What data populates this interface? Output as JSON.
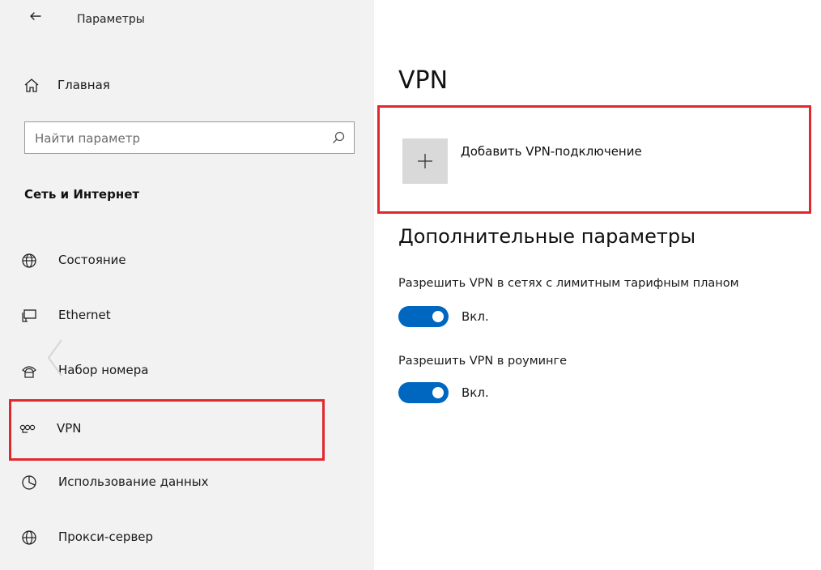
{
  "window": {
    "title": "Параметры"
  },
  "sidebar": {
    "home_label": "Главная",
    "search": {
      "placeholder": "Найти параметр"
    },
    "section_title": "Сеть и Интернет",
    "items": [
      {
        "label": "Состояние",
        "icon": "globe-status-icon"
      },
      {
        "label": "Ethernet",
        "icon": "ethernet-icon"
      },
      {
        "label": "Набор номера",
        "icon": "dialup-phone-icon"
      },
      {
        "label": "VPN",
        "icon": "vpn-icon",
        "selected": true
      },
      {
        "label": "Использование данных",
        "icon": "data-usage-icon"
      },
      {
        "label": "Прокси-сервер",
        "icon": "globe-icon"
      }
    ]
  },
  "main": {
    "title": "VPN",
    "add_vpn_label": "Добавить VPN-подключение",
    "advanced_heading": "Дополнительные параметры",
    "settings": [
      {
        "label": "Разрешить VPN в сетях с лимитным тарифным планом",
        "state": "Вкл.",
        "on": true
      },
      {
        "label": "Разрешить VPN в роуминге",
        "state": "Вкл.",
        "on": true
      }
    ]
  },
  "colors": {
    "accent": "#0067c0",
    "highlight_border": "#e0282e",
    "sidebar_bg": "#f2f2f2"
  }
}
